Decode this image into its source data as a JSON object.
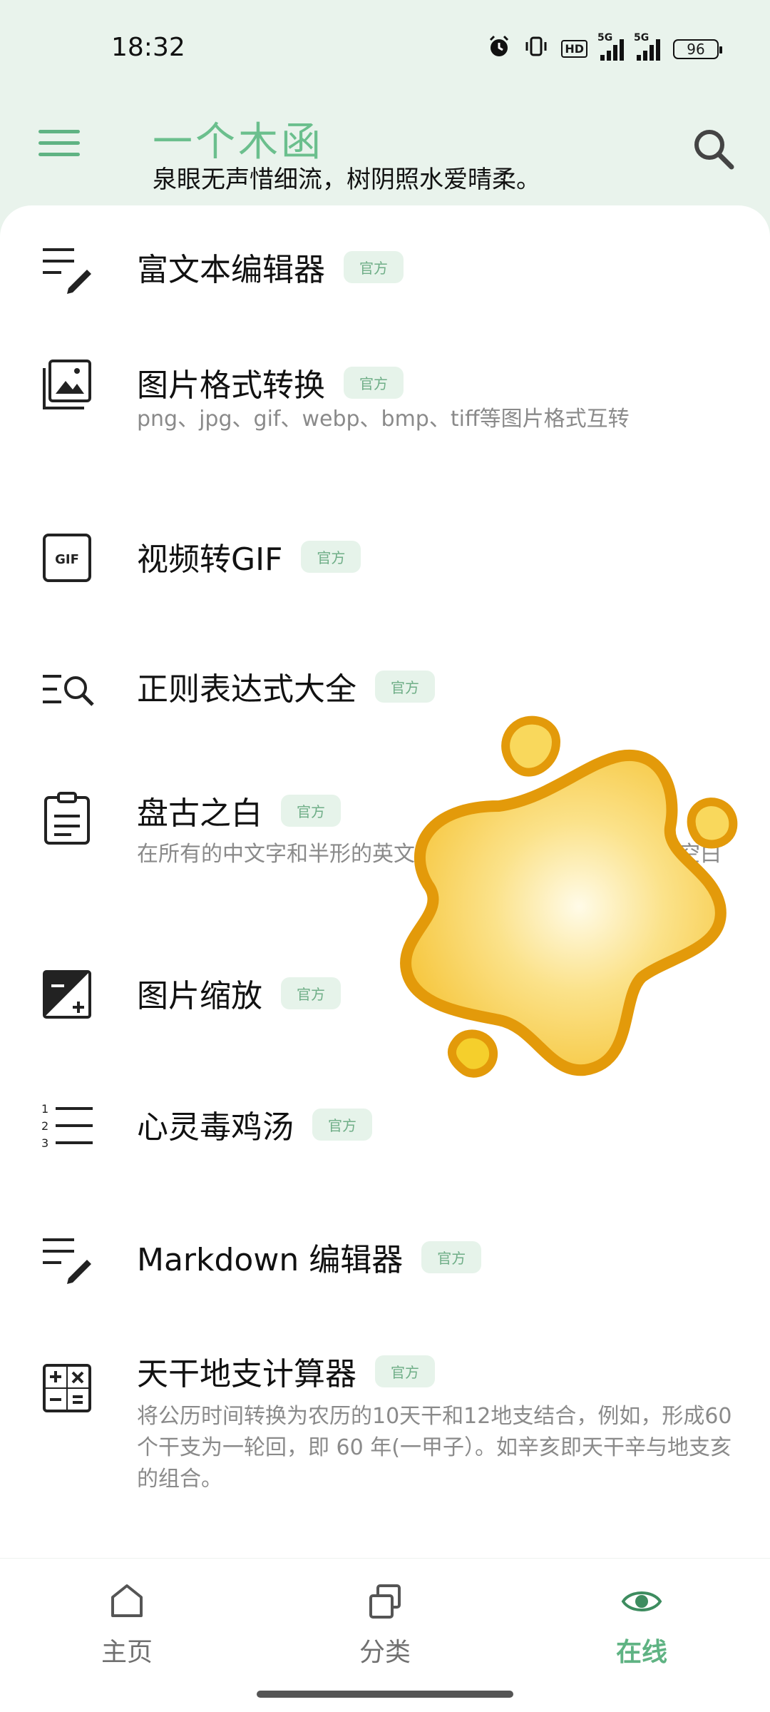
{
  "status_bar": {
    "time": "18:32",
    "hd_label": "HD",
    "signal1_label": "5G",
    "signal2_label": "5G",
    "battery": "96"
  },
  "app_bar": {
    "title": "一个木函",
    "subtitle": "泉眼无声惜细流，树阴照水爱晴柔。"
  },
  "items": [
    {
      "title": "富文本编辑器",
      "badge": "官方",
      "desc": "",
      "icon": "rich-text-edit-icon"
    },
    {
      "title": "图片格式转换",
      "badge": "官方",
      "desc": "png、jpg、gif、webp、bmp、tiff等图片格式互转",
      "icon": "image-convert-icon"
    },
    {
      "title": "视频转GIF",
      "badge": "官方",
      "desc": "",
      "icon": "gif-icon"
    },
    {
      "title": "正则表达式大全",
      "badge": "官方",
      "desc": "",
      "icon": "regex-search-icon"
    },
    {
      "title": "盘古之白",
      "badge": "官方",
      "desc": "在所有的中文字和半形的英文",
      "desc_tail": "空白",
      "icon": "clipboard-icon"
    },
    {
      "title": "图片缩放",
      "badge": "官方",
      "desc": "",
      "icon": "image-scale-icon"
    },
    {
      "title": "心灵毒鸡汤",
      "badge": "官方",
      "desc": "",
      "icon": "numbered-list-icon"
    },
    {
      "title": "Markdown 编辑器",
      "badge": "官方",
      "desc": "",
      "icon": "markdown-edit-icon"
    },
    {
      "title": "天干地支计算器",
      "badge": "官方",
      "desc": "将公历时间转换为农历的10天干和12地支结合，例如，形成60个干支为一轮回，即 60 年(一甲子）。如辛亥即天干辛与地支亥的组合。",
      "icon": "calculator-icon"
    }
  ],
  "bottom_nav": {
    "home": "主页",
    "category": "分类",
    "online": "在线"
  },
  "colors": {
    "accent": "#5fb383",
    "header_bg": "#e9f3ec",
    "badge_bg": "#e6f3ea",
    "badge_text": "#6fae87",
    "blob_fill": "#f9d85c",
    "blob_stroke": "#e39a0a"
  }
}
